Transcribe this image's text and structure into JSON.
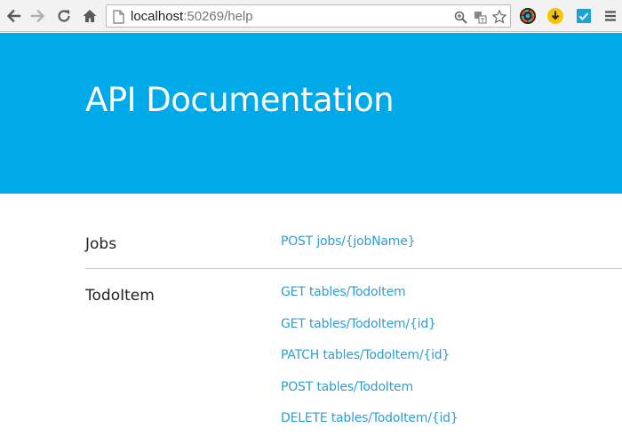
{
  "browser": {
    "url_host": "localhost",
    "url_rest": ":50269/help",
    "back_icon": "back-arrow-icon",
    "forward_icon": "forward-arrow-icon",
    "reload_icon": "reload-icon",
    "home_icon": "home-icon",
    "zoom_icon": "zoom-icon",
    "translate_icon": "translate-icon",
    "bookmark_icon": "star-icon",
    "menu_icon": "hamburger-menu-icon"
  },
  "page": {
    "title": "API Documentation"
  },
  "sections": [
    {
      "name": "Jobs",
      "links": [
        "POST jobs/{jobName}"
      ]
    },
    {
      "name": "TodoItem",
      "links": [
        "GET tables/TodoItem",
        "GET tables/TodoItem/{id}",
        "PATCH tables/TodoItem/{id}",
        "POST tables/TodoItem",
        "DELETE tables/TodoItem/{id}"
      ]
    }
  ],
  "colors": {
    "banner": "#00a9e8",
    "link": "#2f9fd0"
  }
}
